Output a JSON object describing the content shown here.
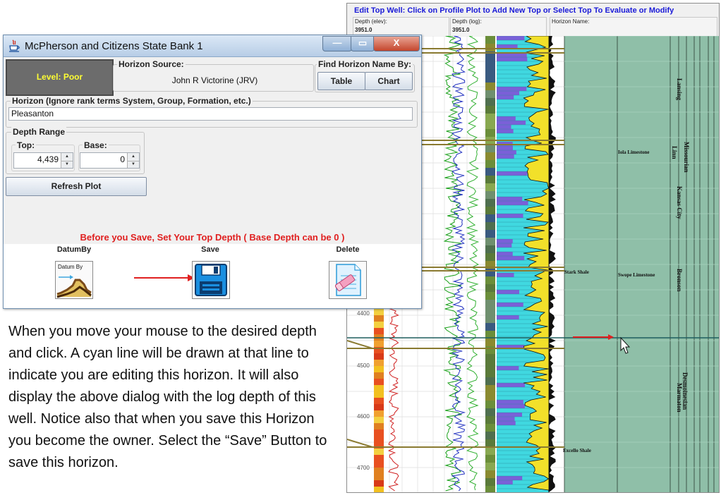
{
  "plot_window": {
    "title": "Edit Top Well: Click on Profile Plot to Add New Top or Select Top To Evaluate or Modify",
    "fields": [
      {
        "label": "Depth (elev):",
        "value": "3951.0"
      },
      {
        "label": "Depth (log):",
        "value": "3951.0"
      },
      {
        "label": "Horizon Name:",
        "value": ""
      }
    ],
    "depth_ticks": [
      "4400",
      "4500",
      "4600",
      "4700"
    ],
    "horizon_labels": [
      "Iola Limestone",
      "Stark Shale",
      "Swope Limestone",
      "Excello Shale"
    ],
    "unit_labels": [
      "Lansing",
      "Linn",
      "Missourian",
      "Kansas City",
      "Bronson",
      "Desmoinesian",
      "Marmaton"
    ],
    "colors": {
      "grid_bg": "#8fbfa8",
      "track_bg": "#ffffff",
      "horizon_line": "#8a7a30",
      "edit_line": "#1f5f5f",
      "lime": "#f0e020",
      "cyan": "#40d8e0"
    }
  },
  "dialog": {
    "title": "McPherson and Citizens State Bank 1",
    "window_buttons": {
      "minimize": "—",
      "maximize": "▭",
      "close": "X"
    },
    "level": "Level: Poor",
    "horizon_source": {
      "label": "Horizon Source:",
      "value": "John R Victorine (JRV)"
    },
    "find_by": {
      "label": "Find Horizon Name By:",
      "table_button": "Table",
      "chart_button": "Chart"
    },
    "horizon": {
      "label": "Horizon (Ignore rank terms System, Group, Formation, etc.)",
      "value": "Pleasanton"
    },
    "depth_range": {
      "label": "Depth Range",
      "top_label": "Top:",
      "top_value": "4,439",
      "base_label": "Base:",
      "base_value": "0"
    },
    "refresh_button": "Refresh Plot",
    "warning": "Before you Save, Set Your Top Depth ( Base Depth can be 0 )",
    "actions": {
      "datum_label": "DatumBy",
      "datum_icon_text": "Datum By",
      "save_label": "Save",
      "delete_label": "Delete"
    },
    "colors": {
      "level_bg": "#6c6c6c",
      "level_text": "#ffff33",
      "warning": "#e02020",
      "arrow": "#e02020"
    }
  },
  "description": {
    "paragraph": "When you move your mouse to the desired depth and click.  A cyan line will be drawn at that line to indicate you are editing this horizon.  It will also display the above dialog with the log depth of this well.  Notice also that when you save this Horizon you become the owner.  Select the “Save” Button to save this horizon."
  }
}
